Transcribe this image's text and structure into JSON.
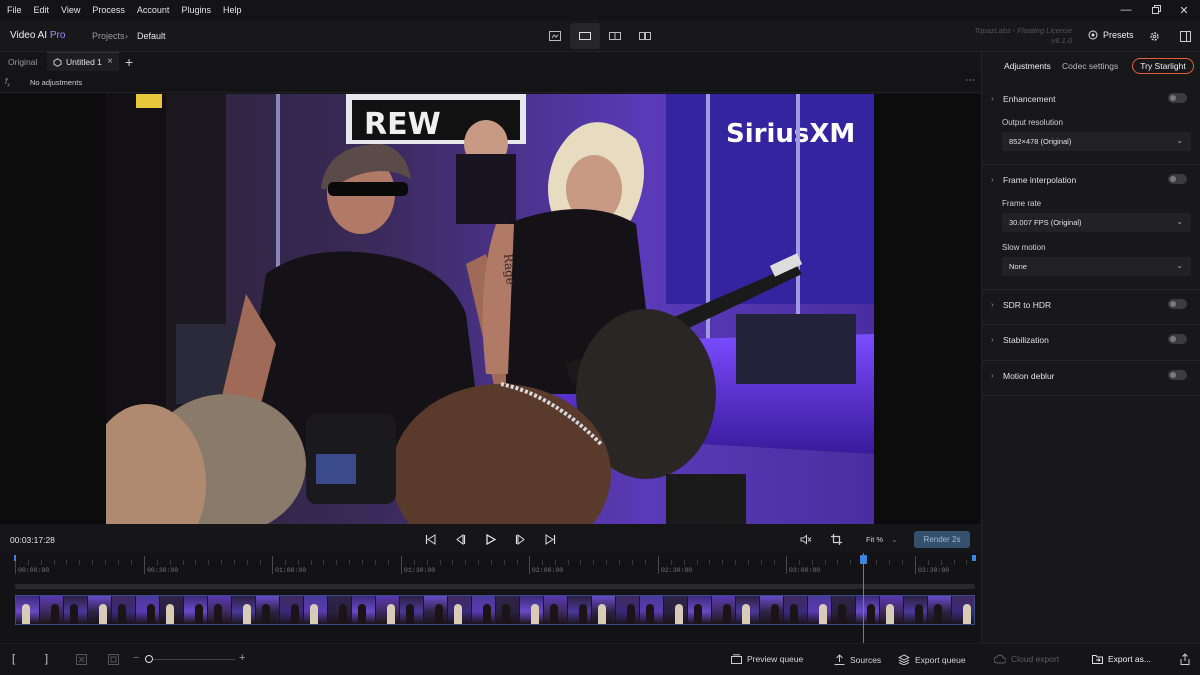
{
  "menu": [
    "File",
    "Edit",
    "View",
    "Process",
    "Account",
    "Plugins",
    "Help"
  ],
  "app": {
    "name": "Video AI",
    "edition": "Pro"
  },
  "breadcrumb": {
    "root": "Projects",
    "current": "Default"
  },
  "license": {
    "line1": "TopazLabs - Floating License",
    "line2": "v6.1.0"
  },
  "toolbar": {
    "presets": "Presets"
  },
  "tabs": {
    "original": "Original",
    "active": "Untitled 1"
  },
  "adjustments_status": "No adjustments",
  "transport": {
    "timecode": "00:03:17:28",
    "zoom": "Fit %",
    "render": "Render 2s"
  },
  "timeline": {
    "labels": [
      "00:00:00",
      "00:30:00",
      "01:00:00",
      "01:30:00",
      "02:00:00",
      "02:30:00",
      "03:00:00",
      "03:30:00"
    ]
  },
  "bottom": {
    "preview_queue": "Preview queue",
    "sources": "Sources",
    "export_queue": "Export queue",
    "cloud_export": "Cloud export",
    "export_as": "Export as..."
  },
  "panel": {
    "tabs": {
      "adjustments": "Adjustments",
      "codec": "Codec settings",
      "starlight": "Try Starlight"
    },
    "enhancement": "Enhancement",
    "output_resolution_label": "Output resolution",
    "output_resolution": "852×478 (Original)",
    "frame_interpolation": "Frame interpolation",
    "frame_rate_label": "Frame rate",
    "frame_rate": "30.007 FPS (Original)",
    "slow_motion_label": "Slow motion",
    "slow_motion": "None",
    "sdr_hdr": "SDR to HDR",
    "stabilization": "Stabilization",
    "motion_deblur": "Motion deblur"
  },
  "video_scene": {
    "banner_text": "REW",
    "sign_text": "SiriusXM",
    "tattoo_text": "Rage"
  },
  "colors": {
    "accent": "#3b87e0",
    "starlight": "#e0603a",
    "pro": "#9e8fff"
  }
}
